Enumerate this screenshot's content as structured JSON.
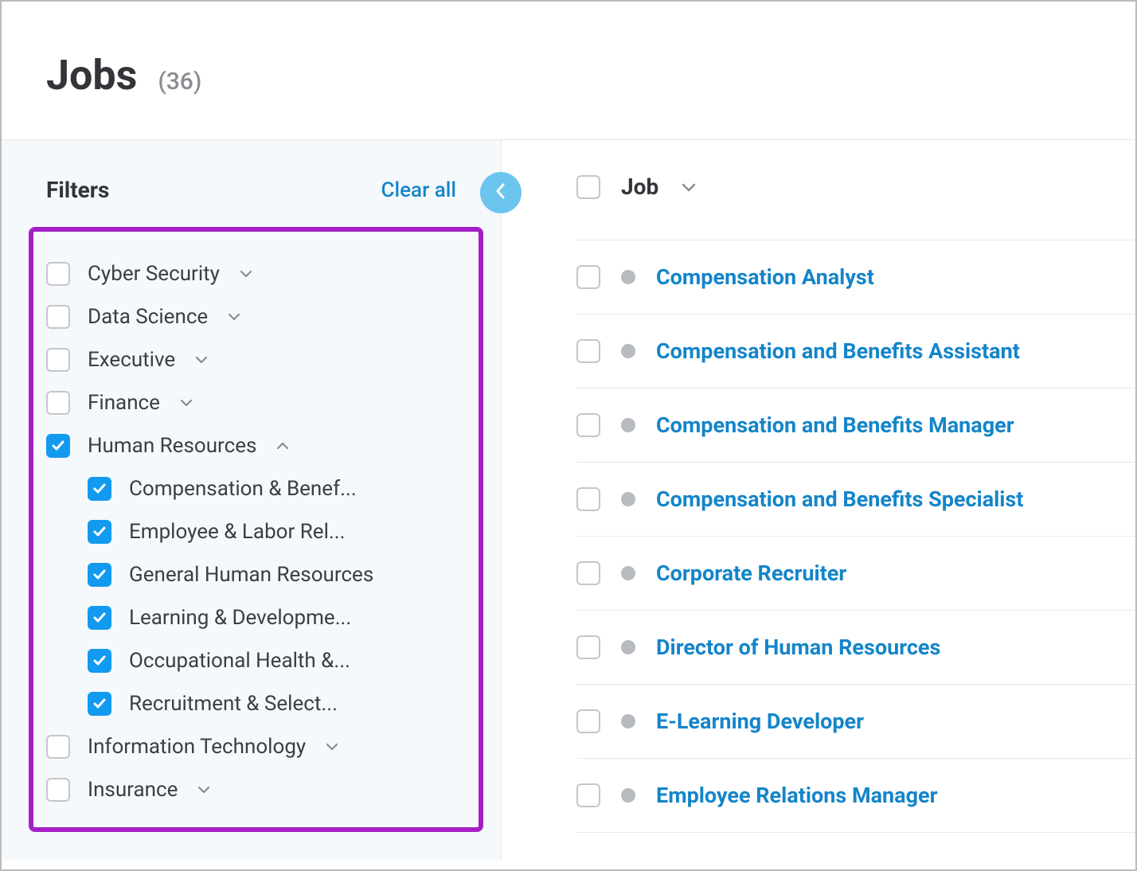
{
  "header": {
    "title": "Jobs",
    "count": "(36)"
  },
  "sidebar": {
    "filters_label": "Filters",
    "clear_all_label": "Clear all",
    "filters": [
      {
        "label": "Cyber Security",
        "checked": false,
        "expanded": false
      },
      {
        "label": "Data Science",
        "checked": false,
        "expanded": false
      },
      {
        "label": "Executive",
        "checked": false,
        "expanded": false
      },
      {
        "label": "Finance",
        "checked": false,
        "expanded": false
      },
      {
        "label": "Human Resources",
        "checked": true,
        "expanded": true,
        "children": [
          {
            "label": "Compensation & Benef...",
            "checked": true
          },
          {
            "label": "Employee & Labor Rel...",
            "checked": true
          },
          {
            "label": "General Human Resources",
            "checked": true
          },
          {
            "label": "Learning & Developme...",
            "checked": true
          },
          {
            "label": "Occupational Health &...",
            "checked": true
          },
          {
            "label": "Recruitment & Select...",
            "checked": true
          }
        ]
      },
      {
        "label": "Information Technology",
        "checked": false,
        "expanded": false
      },
      {
        "label": "Insurance",
        "checked": false,
        "expanded": false
      }
    ]
  },
  "main": {
    "column_label": "Job",
    "jobs": [
      {
        "title": "Compensation Analyst"
      },
      {
        "title": "Compensation and Benefits Assistant"
      },
      {
        "title": "Compensation and Benefits Manager"
      },
      {
        "title": "Compensation and Benefits Specialist"
      },
      {
        "title": "Corporate Recruiter"
      },
      {
        "title": "Director of Human Resources"
      },
      {
        "title": "E-Learning Developer"
      },
      {
        "title": "Employee Relations Manager"
      }
    ]
  }
}
